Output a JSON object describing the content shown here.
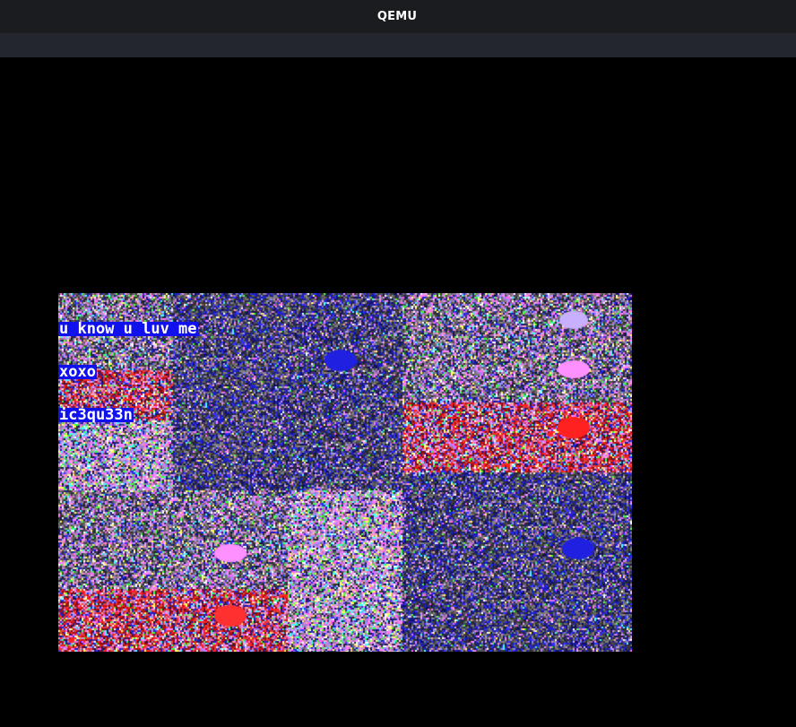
{
  "window": {
    "title": "QEMU"
  },
  "colors": {
    "titlebar": "#1b1c20",
    "menubar": "#23262c",
    "display_bg": "#000000",
    "banner_bg": "#1111ee",
    "banner_text": "#ffffff"
  },
  "guest_screen": {
    "message_lines": [
      "u know u luv me",
      "xoxo",
      "ic3qu33n"
    ],
    "description_icon": "glitch-art-image"
  }
}
